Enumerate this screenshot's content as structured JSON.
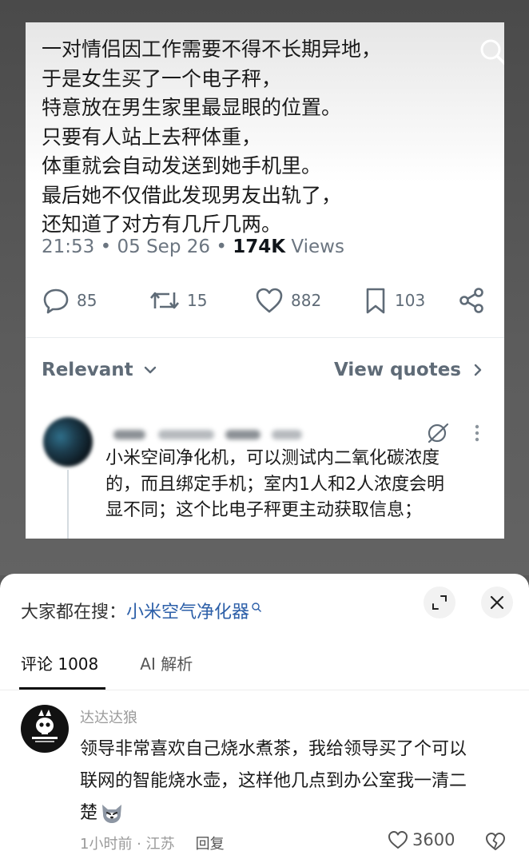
{
  "tweet": {
    "lines": [
      "一对情侣因工作需要不得不长期异地，",
      "于是女生买了一个电子秤，",
      "特意放在男生家里最显眼的位置。",
      "只要有人站上去秤体重，",
      "体重就会自动发送到她手机里。",
      "最后她不仅借此发现男友出轨了，",
      "还知道了对方有几斤几两。"
    ],
    "time": "21:53",
    "date": "05 Sep 26",
    "views_count": "174K",
    "views_label": "Views",
    "replies": "85",
    "retweets": "15",
    "likes": "882",
    "bookmarks": "103",
    "icons": [
      "search-icon",
      "reply-icon",
      "retweet-icon",
      "heart-icon",
      "bookmark-icon",
      "share-icon"
    ]
  },
  "replies_section": {
    "sort_label": "Relevant",
    "view_quotes": "View quotes",
    "reply": {
      "lines": [
        "小米空间净化机，可以测试内二氧化碳浓度",
        "的，而且绑定手机；室内1人和2人浓度会明",
        "显不同；这个比电子秤更主动获取信息；"
      ]
    }
  },
  "sheet": {
    "hot_search_label": "大家都在搜：",
    "hot_search_link": "小米空气净化器",
    "tabs": [
      {
        "label": "评论 1008",
        "active": true
      },
      {
        "label": "AI 解析",
        "active": false
      }
    ],
    "comment": {
      "username": "达达达狼",
      "lines": [
        "领导非常喜欢自己烧水煮茶，我给领导买了个可以",
        "联网的智能烧水壶，这样他几点到办公室我一清二",
        "楚"
      ],
      "emoji": "wolf-face-icon",
      "meta": "1小时前 · 江苏",
      "reply_label": "回复",
      "likes": "3600"
    }
  },
  "colors": {
    "link": "#2c5fa8",
    "muted": "#6b7580",
    "backdrop": "#595959"
  }
}
